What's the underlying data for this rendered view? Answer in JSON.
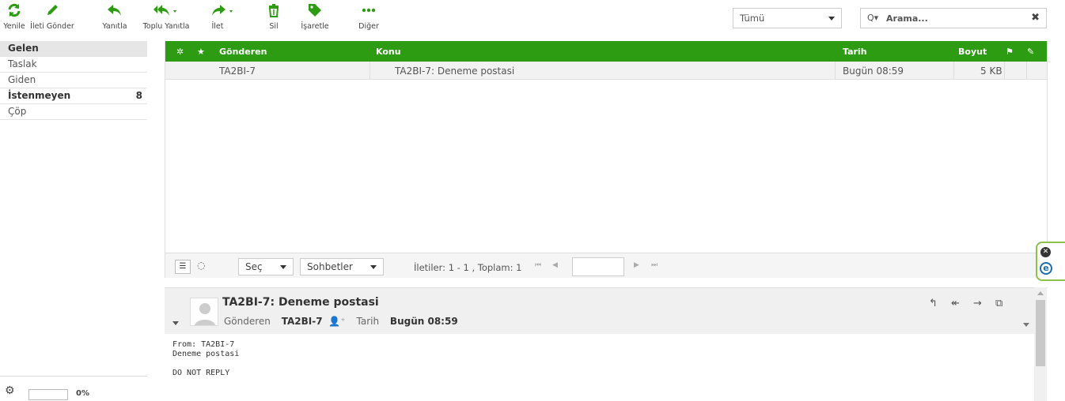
{
  "toolbar": {
    "refresh": "Yenile",
    "compose": "İleti Gönder",
    "reply": "Yanıtla",
    "reply_all": "Toplu Yanıtla",
    "forward": "İlet",
    "delete": "Sil",
    "mark": "İşaretle",
    "more": "Diğer",
    "filter_value": "Tümü",
    "search_placeholder": "Arama...",
    "accent_color": "#2d9c12"
  },
  "sidebar": {
    "folders": [
      {
        "label": "Gelen",
        "active": true
      },
      {
        "label": "Taslak"
      },
      {
        "label": "Giden"
      },
      {
        "label": "İstenmeyen",
        "count": "8"
      },
      {
        "label": "Çöp"
      }
    ],
    "quota": "0%"
  },
  "list": {
    "headers": {
      "from": "Gönderen",
      "subject": "Konu",
      "date": "Tarih",
      "size": "Boyut"
    },
    "rows": [
      {
        "from": "TA2BI-7",
        "subject": "TA2BI-7: Deneme postasi",
        "date": "Bugün 08:59",
        "size": "5 KB"
      }
    ],
    "footer": {
      "select": "Seç",
      "threads": "Sohbetler",
      "count_text": "İletiler: 1 - 1 , Toplam: 1"
    }
  },
  "preview": {
    "subject": "TA2BI-7: Deneme postasi",
    "from_label": "Gönderen",
    "from_value": "TA2BI-7",
    "date_label": "Tarih",
    "date_value": "Bugün 08:59",
    "body": "From: TA2BI-7\nDeneme postasi\n\nDO NOT REPLY"
  }
}
